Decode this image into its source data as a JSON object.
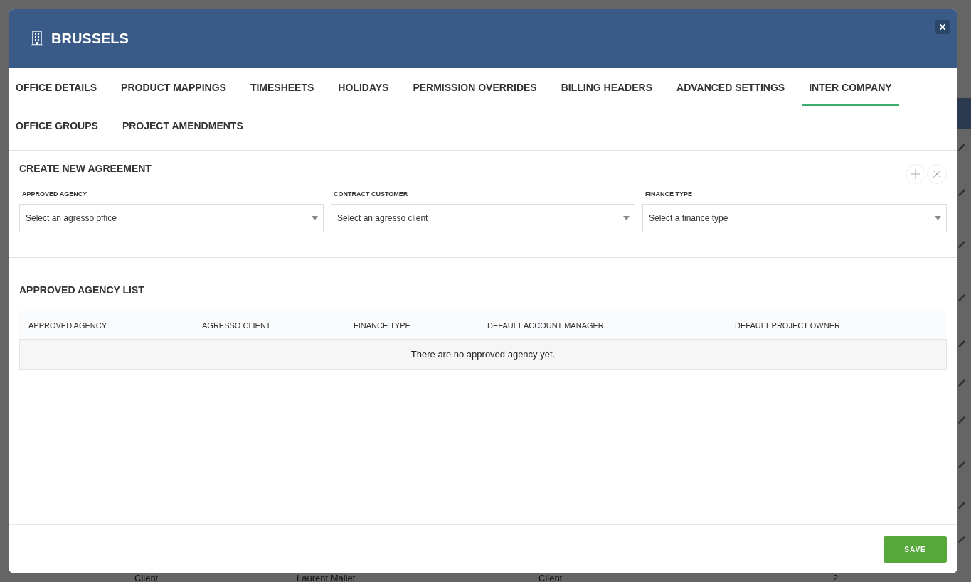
{
  "dialog": {
    "title": "BRUSSELS"
  },
  "tabs": [
    {
      "label": "OFFICE DETAILS",
      "selected": false
    },
    {
      "label": "PRODUCT MAPPINGS",
      "selected": false
    },
    {
      "label": "TIMESHEETS",
      "selected": false
    },
    {
      "label": "HOLIDAYS",
      "selected": false
    },
    {
      "label": "PERMISSION OVERRIDES",
      "selected": false
    },
    {
      "label": "BILLING HEADERS",
      "selected": false
    },
    {
      "label": "ADVANCED SETTINGS",
      "selected": false
    },
    {
      "label": "INTER COMPANY",
      "selected": true
    },
    {
      "label": "OFFICE GROUPS",
      "selected": false
    },
    {
      "label": "PROJECT AMENDMENTS",
      "selected": false
    }
  ],
  "create_section": {
    "title": "CREATE NEW AGREEMENT",
    "fields": [
      {
        "label": "APPROVED AGENCY",
        "placeholder": "Select an agresso office"
      },
      {
        "label": "CONTRACT CUSTOMER",
        "placeholder": "Select an agresso client"
      },
      {
        "label": "FINANCE TYPE",
        "placeholder": "Select a finance type"
      }
    ]
  },
  "list_section": {
    "title": "APPROVED AGENCY LIST",
    "columns": [
      "APPROVED AGENCY",
      "AGRESSO CLIENT",
      "FINANCE TYPE",
      "DEFAULT ACCOUNT MANAGER",
      "DEFAULT PROJECT OWNER"
    ],
    "empty_message": "There are no approved agency yet."
  },
  "footer": {
    "save_button": "SAVE"
  },
  "background_row": {
    "cells": [
      "Client",
      "Laurent Mallet",
      "Client",
      "2"
    ]
  }
}
